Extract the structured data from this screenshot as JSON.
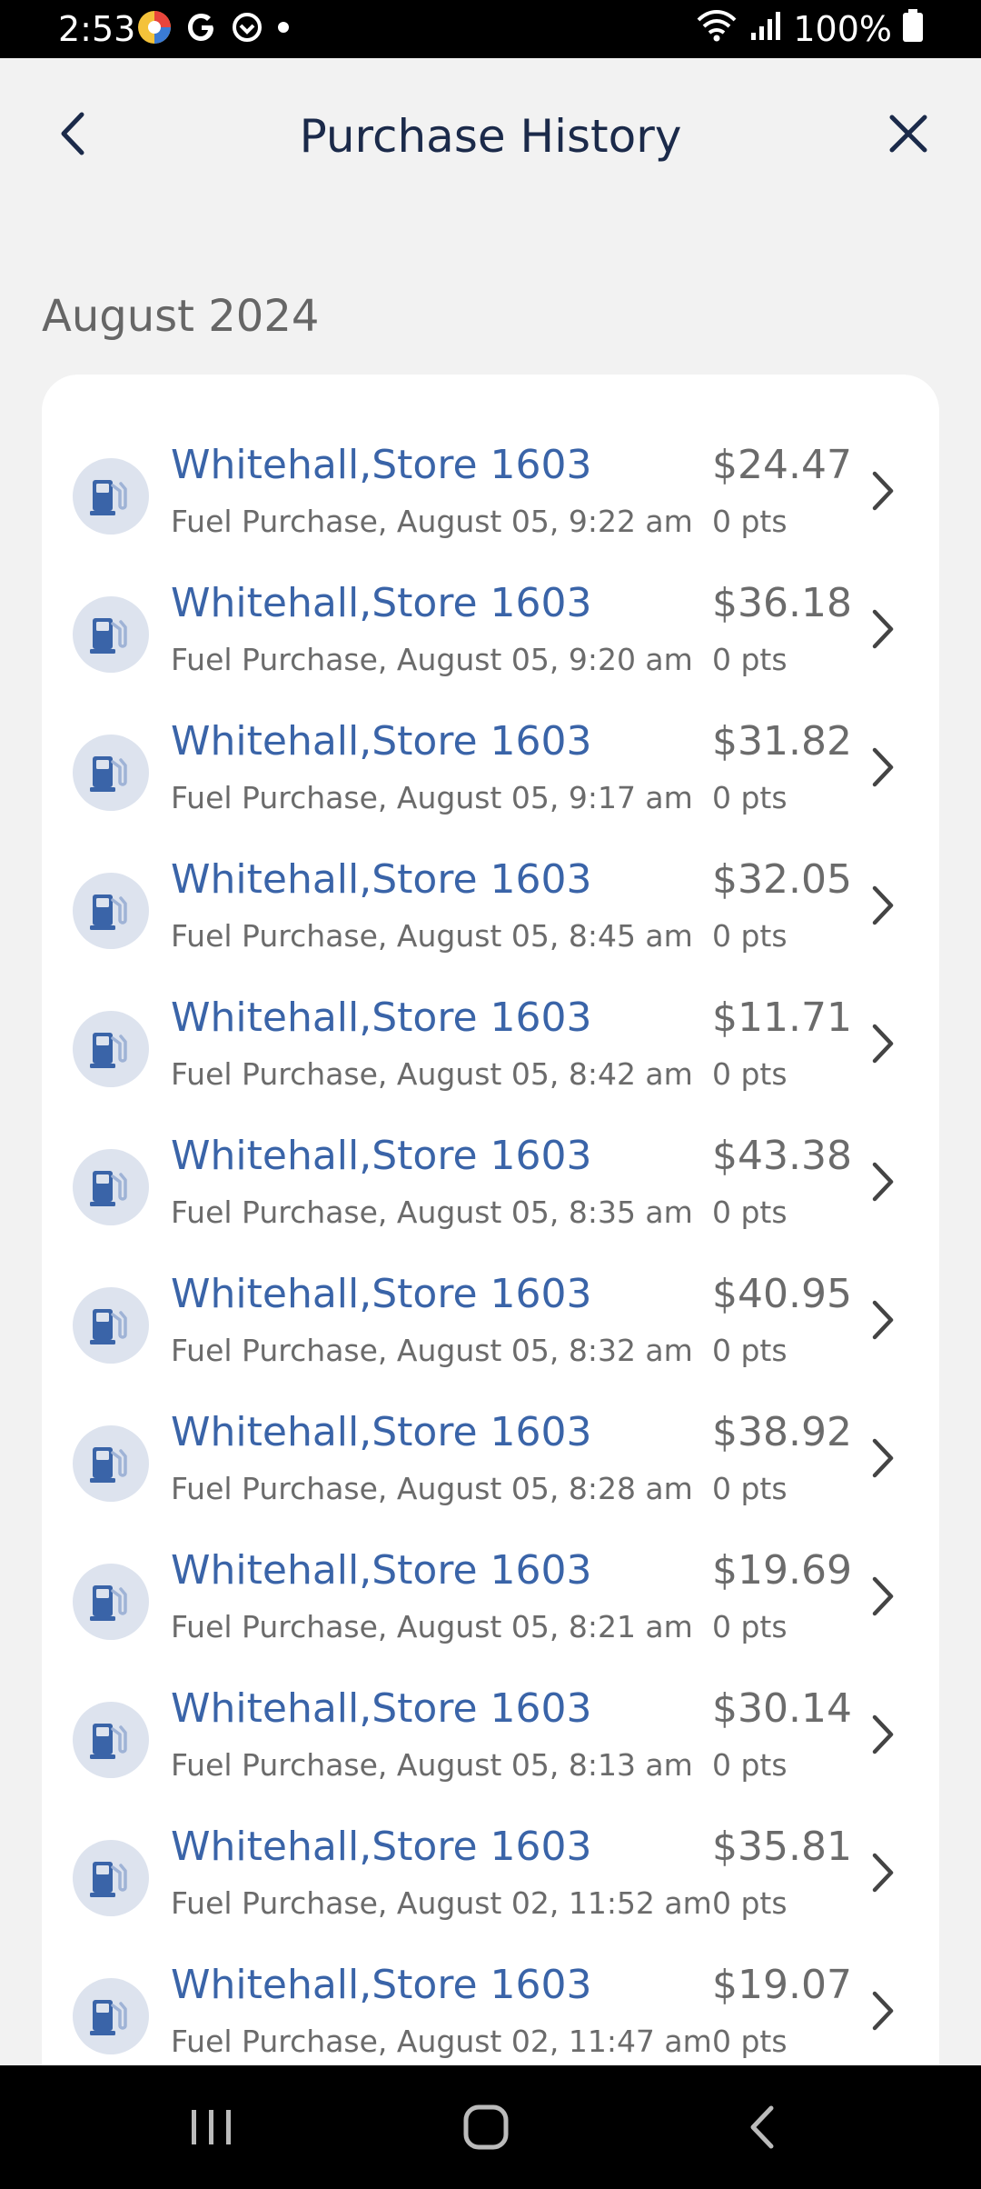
{
  "status_bar": {
    "time": "2:53",
    "battery": "100%"
  },
  "header": {
    "title": "Purchase History"
  },
  "month": "August 2024",
  "colors": {
    "title_blue": "#3a64a8",
    "icon_bg": "#dde3ee",
    "text_grey": "#6b6b6b"
  },
  "purchases": [
    {
      "store": "Whitehall,Store 1603",
      "detail": "Fuel Purchase,  August 05, 9:22 am",
      "amount": "$24.47",
      "points": "0 pts"
    },
    {
      "store": "Whitehall,Store 1603",
      "detail": "Fuel Purchase,  August 05, 9:20 am",
      "amount": "$36.18",
      "points": "0 pts"
    },
    {
      "store": "Whitehall,Store 1603",
      "detail": "Fuel Purchase,  August 05, 9:17 am",
      "amount": "$31.82",
      "points": "0 pts"
    },
    {
      "store": "Whitehall,Store 1603",
      "detail": "Fuel Purchase,  August 05, 8:45 am",
      "amount": "$32.05",
      "points": "0 pts"
    },
    {
      "store": "Whitehall,Store 1603",
      "detail": "Fuel Purchase,  August 05, 8:42 am",
      "amount": "$11.71",
      "points": "0 pts"
    },
    {
      "store": "Whitehall,Store 1603",
      "detail": "Fuel Purchase,  August 05, 8:35 am",
      "amount": "$43.38",
      "points": "0 pts"
    },
    {
      "store": "Whitehall,Store 1603",
      "detail": "Fuel Purchase,  August 05, 8:32 am",
      "amount": "$40.95",
      "points": "0 pts"
    },
    {
      "store": "Whitehall,Store 1603",
      "detail": "Fuel Purchase,  August 05, 8:28 am",
      "amount": "$38.92",
      "points": "0 pts"
    },
    {
      "store": "Whitehall,Store 1603",
      "detail": "Fuel Purchase,  August 05, 8:21 am",
      "amount": "$19.69",
      "points": "0 pts"
    },
    {
      "store": "Whitehall,Store 1603",
      "detail": "Fuel Purchase,  August 05, 8:13 am",
      "amount": "$30.14",
      "points": "0 pts"
    },
    {
      "store": "Whitehall,Store 1603",
      "detail": "Fuel Purchase,  August 02, 11:52 am",
      "amount": "$35.81",
      "points": "0 pts"
    },
    {
      "store": "Whitehall,Store 1603",
      "detail": "Fuel Purchase,  August 02, 11:47 am",
      "amount": "$19.07",
      "points": "0 pts"
    }
  ]
}
